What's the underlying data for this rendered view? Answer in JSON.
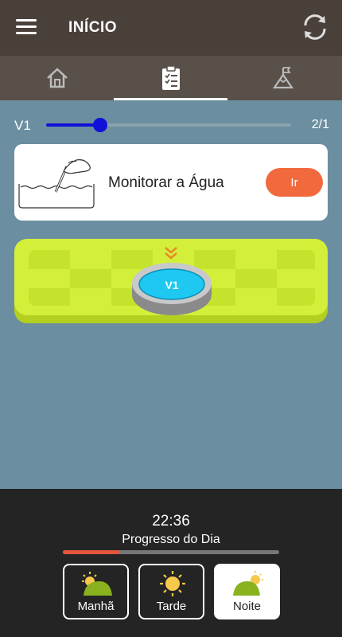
{
  "header": {
    "title": "INÍCIO",
    "menu_icon": "hamburger-menu-icon",
    "sync_icon": "sync-icon"
  },
  "tabs": [
    {
      "icon": "home-icon",
      "selected": false
    },
    {
      "icon": "checklist-clipboard-icon",
      "selected": true
    },
    {
      "icon": "mountain-flag-icon",
      "selected": false
    }
  ],
  "progress": {
    "level_label": "V1",
    "count": "2/1",
    "slider_fraction": 0.22
  },
  "task": {
    "label": "Monitorar a Água",
    "button_label": "Ir",
    "illustration": "water-testing-pipette-illustration"
  },
  "board": {
    "node_label": "V1",
    "marker_icon": "double-chevron-down-icon"
  },
  "footer": {
    "time": "22:36",
    "progress_label": "Progresso do Dia",
    "day_progress": 0.26,
    "periods": [
      {
        "label": "Manhã",
        "icon": "sun-behind-hill-icon",
        "selected": false
      },
      {
        "label": "Tarde",
        "icon": "sun-icon",
        "selected": false
      },
      {
        "label": "Noite",
        "icon": "sun-behind-hill-icon",
        "selected": true
      }
    ]
  },
  "colors": {
    "appbar": "#4a403a",
    "tabbar": "#5a504a",
    "background": "#6b8fa0",
    "slider": "#1010d8",
    "accent": "#f16a3d",
    "board": "#d4ef3a",
    "node": "#1ec8f0",
    "footer": "#242424",
    "day_progress": "#e4573b"
  }
}
